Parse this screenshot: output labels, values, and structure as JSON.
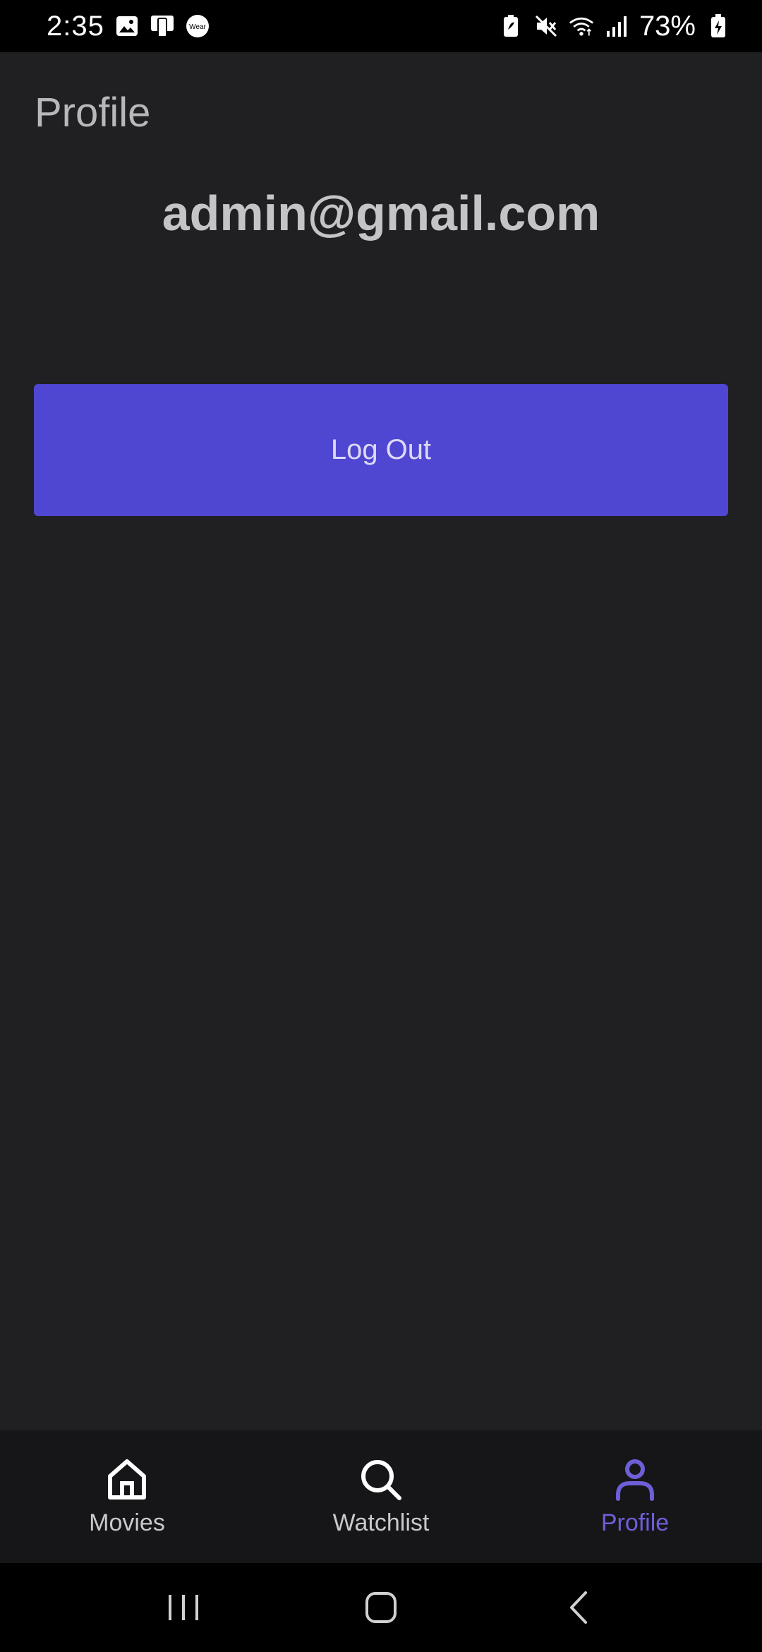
{
  "status_bar": {
    "time": "2:35",
    "battery_percent": "73%",
    "left_icons": [
      "gallery-icon",
      "cast-icon",
      "wear-icon"
    ],
    "right_icons": [
      "battery-saver-icon",
      "mute-icon",
      "wifi-icon",
      "signal-icon",
      "battery-icon"
    ]
  },
  "header": {
    "title": "Profile"
  },
  "profile": {
    "email": "admin@gmail.com"
  },
  "actions": {
    "logout_label": "Log Out"
  },
  "bottom_nav": {
    "items": [
      {
        "label": "Movies",
        "icon": "home-icon",
        "active": false
      },
      {
        "label": "Watchlist",
        "icon": "search-icon",
        "active": false
      },
      {
        "label": "Profile",
        "icon": "person-icon",
        "active": true
      }
    ]
  },
  "colors": {
    "background": "#202022",
    "accent": "#4f46d1",
    "active_nav": "#6d5fd8"
  }
}
